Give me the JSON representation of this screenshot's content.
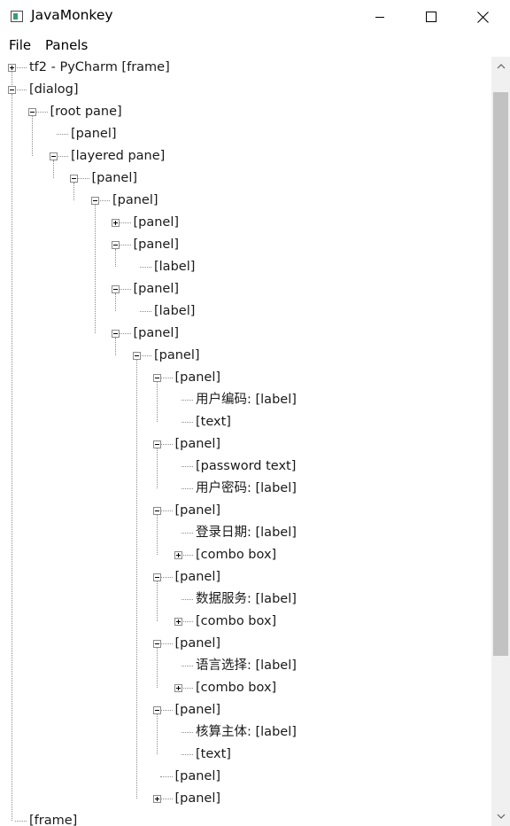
{
  "window": {
    "title": "JavaMonkey",
    "controls": [
      "minimize",
      "maximize",
      "close"
    ]
  },
  "menu": {
    "items": [
      "File",
      "Panels"
    ]
  },
  "tree": [
    {
      "label": "tf2 - PyCharm [frame]",
      "depth": 0,
      "toggle": "plus"
    },
    {
      "label": "[dialog]",
      "depth": 0,
      "toggle": "minus"
    },
    {
      "label": "[root pane]",
      "depth": 1,
      "toggle": "minus"
    },
    {
      "label": "[panel]",
      "depth": 2,
      "toggle": null
    },
    {
      "label": "[layered pane]",
      "depth": 2,
      "toggle": "minus"
    },
    {
      "label": "[panel]",
      "depth": 3,
      "toggle": "minus"
    },
    {
      "label": "[panel]",
      "depth": 4,
      "toggle": "minus"
    },
    {
      "label": "[panel]",
      "depth": 5,
      "toggle": "plus"
    },
    {
      "label": "[panel]",
      "depth": 5,
      "toggle": "minus"
    },
    {
      "label": "[label]",
      "depth": 6,
      "toggle": null
    },
    {
      "label": "[panel]",
      "depth": 5,
      "toggle": "minus"
    },
    {
      "label": "[label]",
      "depth": 6,
      "toggle": null
    },
    {
      "label": "[panel]",
      "depth": 5,
      "toggle": "minus"
    },
    {
      "label": "[panel]",
      "depth": 6,
      "toggle": "minus"
    },
    {
      "label": "[panel]",
      "depth": 7,
      "toggle": "minus"
    },
    {
      "label": "用户编码:  [label]",
      "depth": 8,
      "toggle": null
    },
    {
      "label": "[text]",
      "depth": 8,
      "toggle": null
    },
    {
      "label": "[panel]",
      "depth": 7,
      "toggle": "minus"
    },
    {
      "label": "[password text]",
      "depth": 8,
      "toggle": null
    },
    {
      "label": "用户密码:  [label]",
      "depth": 8,
      "toggle": null
    },
    {
      "label": "[panel]",
      "depth": 7,
      "toggle": "minus"
    },
    {
      "label": "登录日期:  [label]",
      "depth": 8,
      "toggle": null
    },
    {
      "label": "[combo box]",
      "depth": 8,
      "toggle": "plus"
    },
    {
      "label": "[panel]",
      "depth": 7,
      "toggle": "minus"
    },
    {
      "label": "数据服务:  [label]",
      "depth": 8,
      "toggle": null
    },
    {
      "label": "[combo box]",
      "depth": 8,
      "toggle": "plus"
    },
    {
      "label": "[panel]",
      "depth": 7,
      "toggle": "minus"
    },
    {
      "label": "语言选择:  [label]",
      "depth": 8,
      "toggle": null
    },
    {
      "label": "[combo box]",
      "depth": 8,
      "toggle": "plus"
    },
    {
      "label": "[panel]",
      "depth": 7,
      "toggle": "minus"
    },
    {
      "label": "核算主体:  [label]",
      "depth": 8,
      "toggle": null
    },
    {
      "label": "[text]",
      "depth": 8,
      "toggle": null
    },
    {
      "label": "[panel]",
      "depth": 7,
      "toggle": null
    },
    {
      "label": "[panel]",
      "depth": 7,
      "toggle": "plus"
    },
    {
      "label": "[frame]",
      "depth": 0,
      "toggle": null
    }
  ],
  "colors": {
    "background": "#ffffff",
    "connector": "#8c8c8c",
    "scrollbar_track": "#f0f0f0",
    "scrollbar_thumb": "#c2c2c2"
  }
}
